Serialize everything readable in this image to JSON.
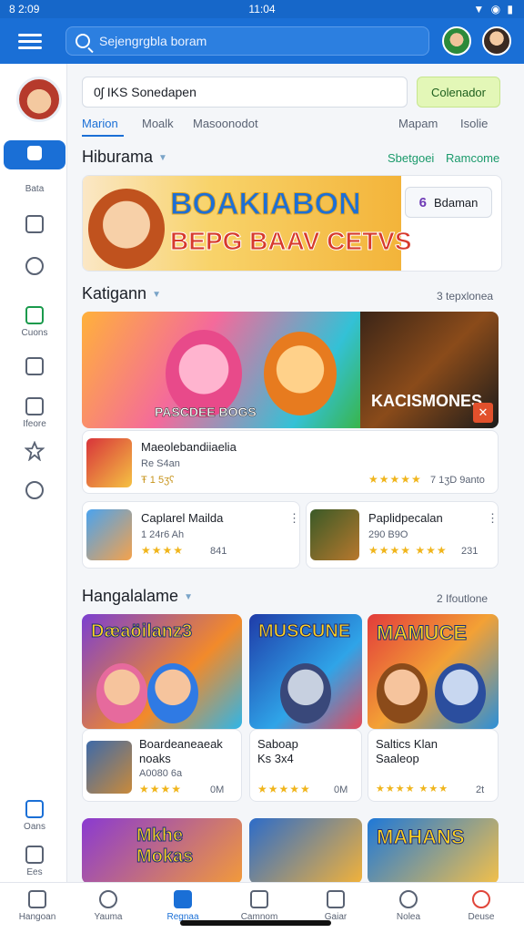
{
  "status": {
    "left": "8 2:09",
    "time": "11:04",
    "right": "▼ ◉ ▮"
  },
  "topbar": {
    "menu_icon": "hamburger-icon",
    "search_placeholder": "Sejengrgbla boram",
    "accent": "#1a6fd6"
  },
  "sidebar": {
    "items": [
      {
        "label": "",
        "icon": "home-icon"
      },
      {
        "label": "Bata",
        "icon": ""
      },
      {
        "label": "",
        "icon": "calendar-icon"
      },
      {
        "label": "",
        "icon": "quote-icon"
      },
      {
        "label": "Cuons",
        "icon": "chat-icon"
      },
      {
        "label": "",
        "icon": "door-icon"
      },
      {
        "label": "Ifeore",
        "icon": "image-icon"
      },
      {
        "label": "",
        "icon": "star-icon"
      },
      {
        "label": "",
        "icon": "shield-icon"
      },
      {
        "label": "Oans",
        "icon": "house-icon"
      },
      {
        "label": "Ees",
        "icon": "settings-icon"
      }
    ]
  },
  "search_row": {
    "value": "0ʃ IKS Sonedapen",
    "cta": "Colenador"
  },
  "tabs": [
    "Marion",
    "Moalk",
    "Masoonodot",
    "Mapam",
    "Isolie"
  ],
  "section1": {
    "title": "Hiburama",
    "link_a": "Sbetgoei",
    "link_b": "Ramcome",
    "banner_line1": "BOAKIABON",
    "banner_line2": "BEPG BAAV CETVS",
    "banner_btn_num": "6",
    "banner_btn_label": "Bdaman"
  },
  "section2": {
    "title": "Katigann",
    "link": "3 tepxlonea",
    "hero_caption_left": "PASCDEE BOGS",
    "hero_caption_right": "KACISMONES",
    "hero_badge": "✕",
    "featured": {
      "title": "Maeolebandiiaelia",
      "meta": "Re S4an",
      "price": "Ŧ 1 5ʒʕ",
      "stars": "★★★★★",
      "count": "7 1ʒD 9anto"
    },
    "cards": [
      {
        "title": "Caplarel Mailda",
        "meta": "1 24r6 Ah",
        "stars": "★★★★",
        "count": "841"
      },
      {
        "title": "Paplidpecalan",
        "meta": "290 B9O",
        "stars": "★★★★ ★★★",
        "count": "231"
      }
    ]
  },
  "section3": {
    "title": "Hangalalame",
    "link": "2 Ifoutlone",
    "tiles": [
      "Dæaöilanz3",
      "MUSCUNE",
      "MAMUCE"
    ],
    "cards": [
      {
        "title": "Boardeaneaeak",
        "title2": "noaks",
        "meta": "A0080 6a",
        "stars": "★★★★",
        "count": "0M"
      },
      {
        "title": "Saboap",
        "title2": "Ks 3x4",
        "meta": "",
        "stars": "★★★★★",
        "count": "0M"
      },
      {
        "title": "Saltics Klan",
        "title2": "Saaleop",
        "meta": "",
        "stars": "★★★★ ★★★",
        "count": "2t"
      }
    ],
    "bottom_tiles": [
      "Mkhe Mokas",
      "",
      "MAHANS"
    ]
  },
  "bottomnav": [
    "Hangoan",
    "Yauma",
    "Regnaa",
    "Camnom",
    "Gaiar",
    "Nolea",
    "Deuse"
  ]
}
